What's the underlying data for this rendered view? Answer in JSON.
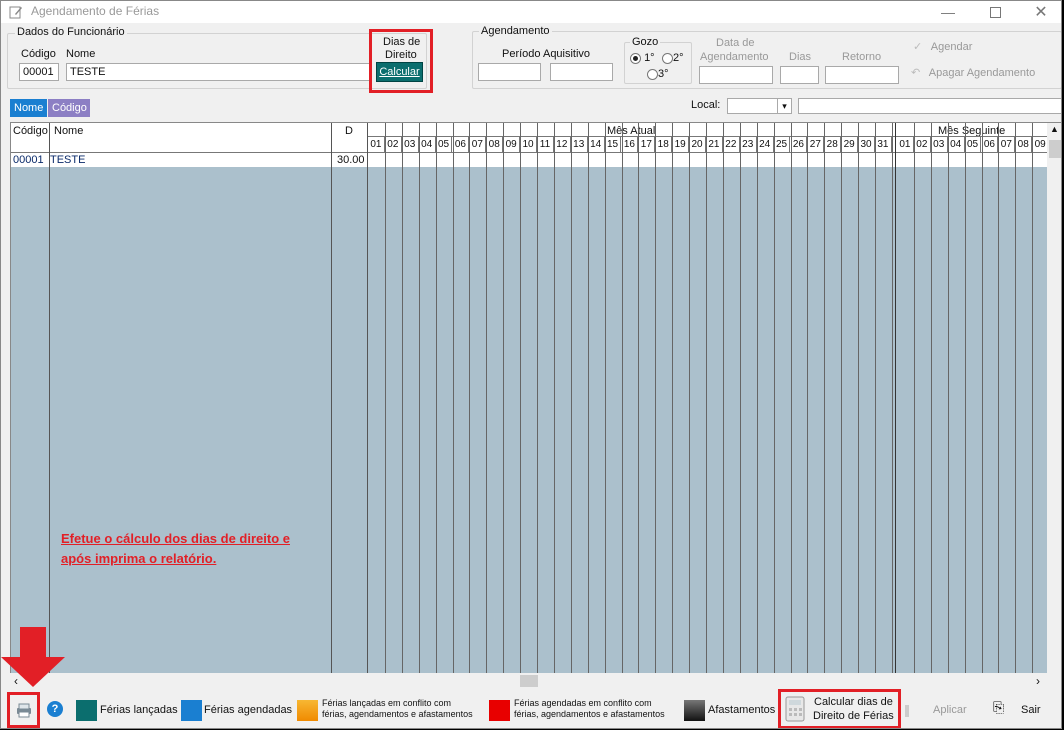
{
  "window": {
    "title": "Agendamento de Férias"
  },
  "funcionario": {
    "group_label": "Dados do Funcionário",
    "codigo_label": "Código",
    "nome_label": "Nome",
    "codigo_value": "00001",
    "nome_value": "TESTE"
  },
  "dias_direito": {
    "label_line1": "Dias de",
    "label_line2": "Direito",
    "button": "Calcular"
  },
  "agendamento": {
    "group_label": "Agendamento",
    "periodo_label": "Período Aquisitivo",
    "gozo_label": "Gozo",
    "gozo_options": [
      "1°",
      "2°",
      "3°"
    ],
    "data_label_1": "Data de",
    "data_label_2": "Agendamento",
    "dias_label": "Dias",
    "retorno_label": "Retorno",
    "agendar": "Agendar",
    "apagar": "Apagar Agendamento"
  },
  "tabs": [
    "Nome",
    "Código"
  ],
  "local": {
    "label": "Local:"
  },
  "grid": {
    "col_codigo": "Código",
    "col_nome": "Nome",
    "col_d": "D",
    "mes_atual": "Mês Atual",
    "mes_seguinte": "Mês Seguinte",
    "days": [
      "01",
      "02",
      "03",
      "04",
      "05",
      "06",
      "07",
      "08",
      "09",
      "10",
      "11",
      "12",
      "13",
      "14",
      "15",
      "16",
      "17",
      "18",
      "19",
      "20",
      "21",
      "22",
      "23",
      "24",
      "25",
      "26",
      "27",
      "28",
      "29",
      "30",
      "31"
    ],
    "next_days": [
      "01",
      "02",
      "03",
      "04",
      "05",
      "06",
      "07",
      "08",
      "09"
    ],
    "rows": [
      {
        "codigo": "00001",
        "nome": "TESTE",
        "d": "30.00"
      }
    ]
  },
  "instruction": {
    "line1": "Efetue o cálculo dos dias de direito e",
    "line2": "após imprima o relatório."
  },
  "legend": {
    "lancadas": "Férias lançadas",
    "agendadas": "Férias agendadas",
    "conflito_lanc_1": "Férias lançadas em conflito com",
    "conflito_lanc_2": "férias, agendamentos e afastamentos",
    "conflito_agend_1": "Férias agendadas em conflito com",
    "conflito_agend_2": "férias, agendamentos e afastamentos",
    "afastamentos": "Afastamentos"
  },
  "footer": {
    "calcular_1": "Calcular dias de",
    "calcular_2": "Direito de Férias",
    "aplicar": "Aplicar",
    "sair": "Sair"
  },
  "colors": {
    "accent_teal": "#0b6e6e",
    "highlight_red": "#e21f26",
    "grid_bg": "#abc0cc",
    "tab_active": "#1a7fd1",
    "tab_inactive": "#8c7fc4"
  }
}
